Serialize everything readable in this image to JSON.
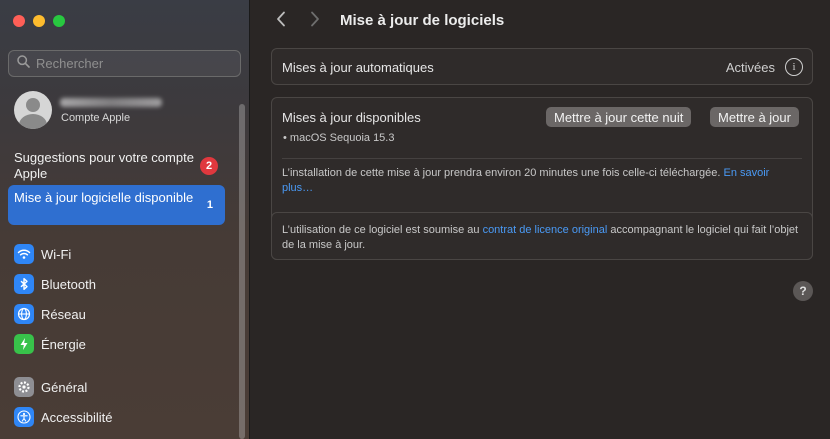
{
  "sidebar": {
    "search_placeholder": "Rechercher",
    "account_subtitle": "Compte Apple",
    "suggestions": {
      "label": "Suggestions pour votre compte Apple",
      "badge": "2"
    },
    "selected_item": {
      "label": "Mise à jour logicielle disponible",
      "count": "1"
    },
    "items": [
      {
        "label": "Wi-Fi",
        "icon": "wifi-icon",
        "color": "#2f86f6"
      },
      {
        "label": "Bluetooth",
        "icon": "bluetooth-icon",
        "color": "#2f86f6"
      },
      {
        "label": "Réseau",
        "icon": "network-globe-icon",
        "color": "#2f86f6"
      },
      {
        "label": "Énergie",
        "icon": "battery-bolt-icon",
        "color": "#38c24a"
      },
      {
        "label": "Général",
        "icon": "gear-icon",
        "color": "#8e8e93"
      },
      {
        "label": "Accessibilité",
        "icon": "accessibility-icon",
        "color": "#2f86f6"
      }
    ]
  },
  "main": {
    "title": "Mise à jour de logiciels",
    "auto_updates": {
      "label": "Mises à jour automatiques",
      "value": "Activées"
    },
    "available": {
      "label": "Mises à jour disponibles",
      "button_tonight": "Mettre à jour cette nuit",
      "button_now": "Mettre à jour",
      "item": "• macOS Sequoia 15.3",
      "install_text": "L’installation de cette mise à jour prendra environ 20 minutes une fois celle-ci téléchargée.",
      "learn_more": "En savoir plus…"
    },
    "license": {
      "text_before": "L’utilisation de ce logiciel est soumise au ",
      "link": "contrat de licence original",
      "text_after": " accompagnant le logiciel qui fait l’objet de la mise à jour."
    },
    "help_label": "?"
  }
}
